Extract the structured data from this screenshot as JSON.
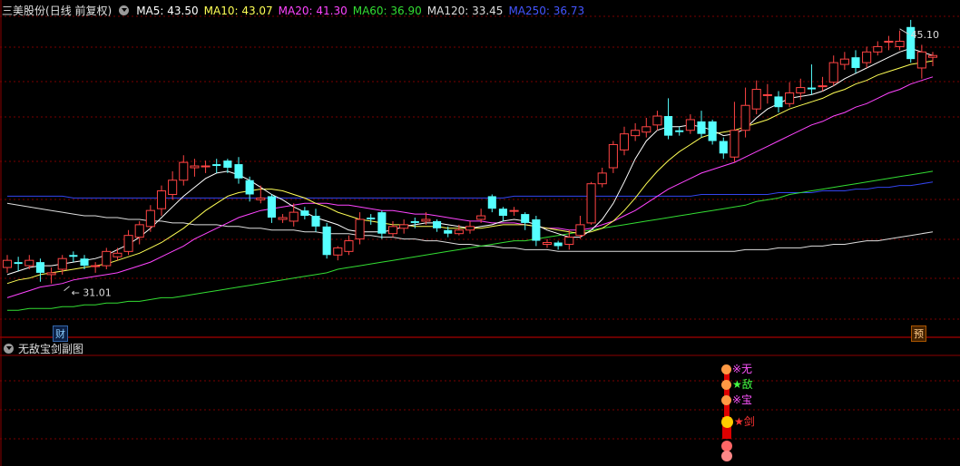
{
  "header": {
    "stock_name": "三美股份",
    "period": "(日线 前复权)",
    "ma": [
      {
        "label": "MA5: 43.50",
        "color": "#ffffff"
      },
      {
        "label": "MA10: 43.07",
        "color": "#ffff55"
      },
      {
        "label": "MA20: 41.30",
        "color": "#ff44ff"
      },
      {
        "label": "MA60: 36.90",
        "color": "#33dd33"
      },
      {
        "label": "MA120: 33.45",
        "color": "#dddddd"
      },
      {
        "label": "MA250: 36.73",
        "color": "#4455ff"
      }
    ]
  },
  "subpanel": {
    "title": "无敌宝剑副图"
  },
  "signals": [
    {
      "text": "※无",
      "color": "#ff55ff",
      "face_color": "#ff9944"
    },
    {
      "text": "★敌",
      "color": "#44ff44",
      "face_color": "#ff9944"
    },
    {
      "text": "※宝",
      "color": "#ff55ff",
      "face_color": "#ff9944"
    },
    {
      "text": "★剑",
      "color": "#ff3333",
      "face_color": "#ffcc00"
    }
  ],
  "markers": {
    "cai": "财",
    "yu": "预"
  },
  "colors": {
    "up": "#ff4444",
    "down": "#55ffff",
    "grid": "#7a0000",
    "axis": "#8b0000"
  },
  "chart_data": {
    "type": "candlestick",
    "high_label": "45.10",
    "low_label": "31.01",
    "ylim": [
      29.0,
      46.0
    ],
    "candles": [
      [
        31.9,
        32.3,
        31.6,
        32.6
      ],
      [
        32.2,
        32.1,
        31.7,
        32.5
      ],
      [
        32.0,
        32.3,
        31.8,
        32.6
      ],
      [
        32.2,
        31.6,
        31.1,
        32.4
      ],
      [
        31.5,
        31.6,
        31.0,
        31.9
      ],
      [
        31.8,
        32.4,
        31.5,
        32.6
      ],
      [
        32.6,
        32.5,
        32.2,
        32.8
      ],
      [
        32.4,
        32.0,
        31.8,
        32.6
      ],
      [
        32.0,
        32.0,
        31.6,
        32.2
      ],
      [
        32.0,
        32.8,
        31.8,
        33.0
      ],
      [
        32.5,
        32.7,
        32.3,
        33.0
      ],
      [
        32.8,
        33.7,
        32.6,
        34.0
      ],
      [
        33.6,
        34.3,
        33.2,
        34.5
      ],
      [
        34.2,
        35.1,
        33.9,
        35.4
      ],
      [
        35.2,
        36.2,
        34.8,
        36.5
      ],
      [
        36.0,
        36.8,
        35.7,
        37.3
      ],
      [
        36.8,
        37.8,
        36.5,
        38.2
      ],
      [
        37.5,
        37.6,
        37.0,
        38.0
      ],
      [
        37.6,
        37.6,
        37.2,
        37.9
      ],
      [
        37.7,
        37.6,
        37.2,
        38.0
      ],
      [
        37.9,
        37.5,
        37.2,
        38.0
      ],
      [
        37.7,
        36.9,
        36.6,
        38.1
      ],
      [
        36.8,
        36.0,
        35.6,
        37.0
      ],
      [
        35.7,
        35.8,
        35.5,
        36.5
      ],
      [
        35.9,
        34.7,
        34.4,
        36.0
      ],
      [
        34.6,
        34.7,
        34.4,
        34.9
      ],
      [
        34.5,
        35.0,
        34.2,
        35.5
      ],
      [
        35.1,
        34.8,
        34.6,
        35.3
      ],
      [
        34.8,
        34.2,
        33.9,
        35.2
      ],
      [
        34.2,
        32.6,
        32.4,
        34.4
      ],
      [
        32.6,
        33.0,
        32.3,
        33.1
      ],
      [
        32.8,
        33.4,
        32.6,
        33.7
      ],
      [
        33.5,
        34.6,
        33.2,
        35.0
      ],
      [
        34.7,
        34.6,
        34.3,
        34.9
      ],
      [
        35.0,
        33.8,
        33.5,
        35.1
      ],
      [
        33.8,
        34.2,
        33.6,
        34.5
      ],
      [
        34.1,
        34.3,
        33.8,
        34.6
      ],
      [
        34.5,
        34.4,
        34.1,
        34.7
      ],
      [
        34.5,
        34.6,
        34.3,
        35.0
      ],
      [
        34.5,
        34.1,
        33.9,
        34.6
      ],
      [
        34.0,
        33.8,
        33.6,
        34.2
      ],
      [
        33.8,
        34.0,
        33.7,
        34.3
      ],
      [
        34.0,
        34.2,
        33.8,
        34.5
      ],
      [
        34.6,
        34.8,
        34.4,
        35.2
      ],
      [
        35.9,
        35.2,
        35.0,
        36.0
      ],
      [
        35.2,
        34.8,
        34.5,
        35.3
      ],
      [
        35.1,
        35.1,
        34.8,
        35.3
      ],
      [
        34.9,
        34.4,
        34.0,
        35.0
      ],
      [
        34.6,
        33.4,
        33.1,
        34.8
      ],
      [
        33.2,
        33.3,
        33.0,
        33.5
      ],
      [
        33.3,
        33.1,
        32.9,
        33.4
      ],
      [
        33.2,
        33.6,
        32.9,
        34.0
      ],
      [
        33.7,
        34.3,
        33.5,
        34.8
      ],
      [
        34.4,
        36.6,
        34.3,
        36.7
      ],
      [
        36.6,
        37.2,
        36.4,
        37.5
      ],
      [
        37.5,
        38.8,
        37.2,
        39.0
      ],
      [
        38.5,
        39.4,
        38.2,
        39.8
      ],
      [
        39.3,
        39.6,
        39.0,
        40.0
      ],
      [
        39.5,
        39.8,
        39.2,
        40.3
      ],
      [
        39.9,
        40.4,
        39.6,
        40.7
      ],
      [
        40.4,
        39.3,
        39.1,
        41.4
      ],
      [
        39.6,
        39.5,
        39.3,
        39.8
      ],
      [
        39.6,
        40.2,
        39.4,
        40.5
      ],
      [
        40.1,
        39.4,
        39.2,
        40.7
      ],
      [
        40.1,
        39.0,
        38.8,
        40.2
      ],
      [
        39.0,
        38.3,
        38.0,
        39.2
      ],
      [
        38.1,
        39.6,
        37.8,
        41.2
      ],
      [
        39.6,
        41.0,
        39.2,
        42.0
      ],
      [
        40.8,
        41.9,
        40.5,
        42.4
      ],
      [
        41.6,
        41.6,
        41.1,
        42.2
      ],
      [
        41.5,
        40.9,
        40.6,
        41.8
      ],
      [
        41.1,
        41.7,
        40.9,
        42.3
      ],
      [
        41.7,
        42.0,
        41.3,
        42.5
      ],
      [
        42.0,
        41.9,
        41.6,
        43.3
      ],
      [
        42.1,
        42.1,
        41.8,
        42.6
      ],
      [
        42.3,
        43.4,
        42.1,
        43.8
      ],
      [
        43.3,
        43.6,
        43.0,
        44.0
      ],
      [
        43.7,
        43.1,
        42.8,
        44.1
      ],
      [
        43.4,
        44.0,
        43.1,
        44.3
      ],
      [
        44.0,
        44.3,
        43.8,
        44.6
      ],
      [
        44.6,
        44.6,
        44.1,
        44.9
      ],
      [
        44.3,
        44.6,
        44.1,
        45.2
      ],
      [
        45.4,
        43.6,
        43.4,
        45.8
      ],
      [
        43.1,
        44.0,
        42.5,
        44.4
      ],
      [
        43.7,
        43.8,
        43.2,
        44.0
      ]
    ],
    "ma5": [
      31.5,
      31.7,
      31.9,
      32.0,
      32.0,
      32.1,
      32.2,
      32.3,
      32.4,
      32.6,
      32.9,
      33.2,
      33.6,
      34.1,
      34.7,
      35.3,
      35.9,
      36.4,
      36.9,
      37.2,
      37.3,
      37.1,
      36.8,
      36.4,
      36.0,
      35.7,
      35.3,
      35.0,
      34.7,
      34.5,
      34.3,
      34.0,
      33.9,
      33.9,
      33.9,
      34.0,
      34.2,
      34.3,
      34.4,
      34.4,
      34.3,
      34.2,
      34.1,
      34.2,
      34.3,
      34.5,
      34.6,
      34.5,
      34.3,
      34.0,
      33.8,
      33.6,
      33.6,
      34.0,
      34.6,
      35.5,
      36.7,
      38.0,
      39.0,
      39.6,
      39.8,
      39.8,
      39.9,
      39.8,
      39.6,
      39.3,
      39.4,
      39.7,
      40.3,
      40.8,
      41.1,
      41.4,
      41.5,
      41.6,
      41.8,
      42.1,
      42.5,
      42.8,
      43.1,
      43.4,
      43.7,
      44.0,
      44.2,
      44.0,
      43.8
    ],
    "ma10": [
      31.0,
      31.2,
      31.3,
      31.5,
      31.6,
      31.7,
      31.8,
      31.9,
      32.0,
      32.1,
      32.3,
      32.5,
      32.7,
      33.0,
      33.3,
      33.7,
      34.1,
      34.6,
      35.1,
      35.5,
      35.9,
      36.1,
      36.2,
      36.3,
      36.3,
      36.2,
      36.0,
      35.8,
      35.5,
      35.3,
      35.0,
      34.8,
      34.6,
      34.5,
      34.4,
      34.3,
      34.3,
      34.2,
      34.2,
      34.2,
      34.1,
      34.1,
      34.1,
      34.1,
      34.2,
      34.3,
      34.3,
      34.3,
      34.2,
      34.1,
      34.0,
      33.9,
      33.8,
      33.9,
      34.1,
      34.5,
      35.1,
      35.8,
      36.6,
      37.3,
      37.9,
      38.4,
      38.8,
      39.2,
      39.4,
      39.5,
      39.6,
      39.8,
      40.0,
      40.2,
      40.5,
      40.8,
      41.0,
      41.2,
      41.4,
      41.7,
      41.9,
      42.2,
      42.4,
      42.7,
      42.9,
      43.1,
      43.3,
      43.4,
      43.5
    ],
    "ma20": [
      30.2,
      30.4,
      30.6,
      30.8,
      30.9,
      31.0,
      31.2,
      31.3,
      31.4,
      31.5,
      31.6,
      31.8,
      32.0,
      32.2,
      32.5,
      32.8,
      33.1,
      33.5,
      33.8,
      34.1,
      34.4,
      34.7,
      34.9,
      35.1,
      35.2,
      35.3,
      35.4,
      35.5,
      35.5,
      35.5,
      35.4,
      35.4,
      35.3,
      35.2,
      35.1,
      35.1,
      35.0,
      34.9,
      34.9,
      34.8,
      34.7,
      34.6,
      34.5,
      34.5,
      34.4,
      34.4,
      34.4,
      34.3,
      34.2,
      34.1,
      34.1,
      34.0,
      34.0,
      34.1,
      34.3,
      34.5,
      34.8,
      35.1,
      35.5,
      35.9,
      36.3,
      36.6,
      36.9,
      37.2,
      37.4,
      37.6,
      37.8,
      38.1,
      38.4,
      38.7,
      39.0,
      39.3,
      39.6,
      39.9,
      40.1,
      40.4,
      40.6,
      40.9,
      41.1,
      41.4,
      41.7,
      41.9,
      42.2,
      42.4,
      42.6
    ],
    "ma60": [
      29.5,
      29.5,
      29.6,
      29.6,
      29.6,
      29.7,
      29.7,
      29.8,
      29.8,
      29.9,
      29.9,
      30.0,
      30.0,
      30.1,
      30.2,
      30.2,
      30.3,
      30.4,
      30.5,
      30.6,
      30.7,
      30.8,
      30.9,
      31.0,
      31.1,
      31.2,
      31.3,
      31.4,
      31.5,
      31.6,
      31.8,
      31.9,
      32.0,
      32.1,
      32.2,
      32.3,
      32.4,
      32.5,
      32.6,
      32.7,
      32.8,
      32.9,
      33.0,
      33.1,
      33.2,
      33.3,
      33.4,
      33.4,
      33.5,
      33.6,
      33.7,
      33.8,
      33.9,
      34.0,
      34.1,
      34.2,
      34.3,
      34.4,
      34.5,
      34.6,
      34.7,
      34.8,
      34.9,
      35.0,
      35.1,
      35.2,
      35.3,
      35.4,
      35.6,
      35.7,
      35.8,
      36.0,
      36.1,
      36.2,
      36.3,
      36.4,
      36.5,
      36.6,
      36.7,
      36.8,
      36.9,
      37.0,
      37.1,
      37.2,
      37.3
    ],
    "ma120": [
      35.5,
      35.4,
      35.3,
      35.2,
      35.1,
      35.0,
      34.9,
      34.8,
      34.8,
      34.7,
      34.7,
      34.6,
      34.6,
      34.5,
      34.5,
      34.4,
      34.4,
      34.3,
      34.3,
      34.3,
      34.2,
      34.2,
      34.1,
      34.1,
      34.0,
      34.0,
      34.0,
      33.9,
      33.9,
      33.8,
      33.8,
      33.8,
      33.7,
      33.7,
      33.6,
      33.6,
      33.5,
      33.5,
      33.4,
      33.4,
      33.3,
      33.2,
      33.2,
      33.1,
      33.1,
      33.0,
      33.0,
      32.9,
      32.9,
      32.9,
      32.8,
      32.8,
      32.8,
      32.8,
      32.8,
      32.8,
      32.8,
      32.8,
      32.8,
      32.8,
      32.8,
      32.8,
      32.8,
      32.8,
      32.8,
      32.8,
      32.8,
      32.9,
      32.9,
      32.9,
      33.0,
      33.0,
      33.0,
      33.1,
      33.1,
      33.2,
      33.2,
      33.3,
      33.4,
      33.4,
      33.5,
      33.6,
      33.7,
      33.8,
      33.9
    ],
    "ma250": [
      35.9,
      35.9,
      35.9,
      35.9,
      35.9,
      35.9,
      35.8,
      35.8,
      35.8,
      35.8,
      35.8,
      35.8,
      35.8,
      35.8,
      35.8,
      35.8,
      35.8,
      35.8,
      35.8,
      35.8,
      35.8,
      35.8,
      35.8,
      35.8,
      35.8,
      35.8,
      35.8,
      35.8,
      35.8,
      35.8,
      35.8,
      35.8,
      35.8,
      35.8,
      35.8,
      35.8,
      35.8,
      35.8,
      35.8,
      35.8,
      35.8,
      35.8,
      35.8,
      35.8,
      35.8,
      35.8,
      35.9,
      35.9,
      35.9,
      35.9,
      35.9,
      35.9,
      35.9,
      35.9,
      35.9,
      35.9,
      35.9,
      35.9,
      35.9,
      35.9,
      35.9,
      35.9,
      35.9,
      36.0,
      36.0,
      36.0,
      36.0,
      36.0,
      36.0,
      36.0,
      36.1,
      36.1,
      36.1,
      36.1,
      36.2,
      36.2,
      36.2,
      36.3,
      36.3,
      36.4,
      36.4,
      36.5,
      36.5,
      36.6,
      36.7
    ]
  }
}
